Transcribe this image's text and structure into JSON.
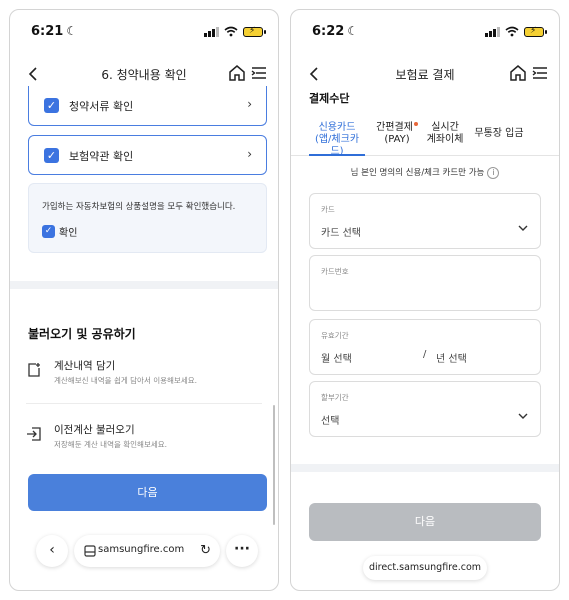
{
  "left": {
    "status": {
      "time": "6:21"
    },
    "nav": {
      "title": "6. 청약내용 확인"
    },
    "checks": [
      {
        "label": "청약서류 확인"
      },
      {
        "label": "보험약관 확인"
      }
    ],
    "confirm": {
      "text": "가입하는 자동차보험의 상품설명을 모두 확인했습니다.",
      "check_label": "확인"
    },
    "share": {
      "title": "불러오기 및 공유하기",
      "items": [
        {
          "title": "계산내역 담기",
          "desc": "계산해보신 내역을 쉽게 담아서 이용해보세요."
        },
        {
          "title": "이전계산 불러오기",
          "desc": "저장해둔 계산 내역을 확인해보세요."
        }
      ]
    },
    "next_button": "다음",
    "browser": {
      "url": "samsungfire.com"
    }
  },
  "right": {
    "status": {
      "time": "6:22"
    },
    "nav": {
      "title": "보험료 결제"
    },
    "section_title": "결제수단",
    "tabs": [
      {
        "line1": "신용카드",
        "line2": "(앱/체크카드)"
      },
      {
        "line1": "간편결제",
        "line2": "(PAY)"
      },
      {
        "line1": "실시간",
        "line2": "계좌이체"
      },
      {
        "line1": "무통장 입금",
        "line2": ""
      }
    ],
    "notice": "님 본인 명의의 신용/체크 카드만 가능",
    "fields": {
      "card": {
        "label": "카드",
        "value": "카드 선택"
      },
      "card_number": {
        "label": "카드번호",
        "value": ""
      },
      "expiry": {
        "label": "유효기간",
        "month": "월 선택",
        "year": "년 선택"
      },
      "installment": {
        "label": "할부기간",
        "value": "선택"
      }
    },
    "next_button": "다음",
    "domain": "direct.samsungfire.com"
  },
  "colors": {
    "primary": "#4a80db",
    "tab_active": "#2f6ed8",
    "disabled": "#b9bcc0",
    "badge_dot": "#e8673a"
  }
}
